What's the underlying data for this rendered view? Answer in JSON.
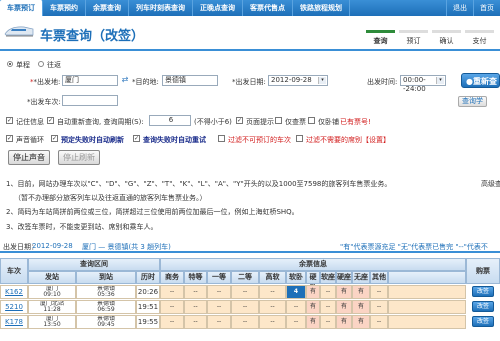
{
  "topnav": {
    "tabs": [
      "车票预订",
      "车票预约",
      "余票查询",
      "列车时刻表查询",
      "正晚点查询",
      "客票代售点",
      "铁路旅程规划"
    ],
    "utils": [
      "退出",
      "首页"
    ]
  },
  "header": {
    "title": "车票查询（改签）",
    "steps": [
      "查询",
      "预订",
      "确认",
      "支付"
    ]
  },
  "search": {
    "trip_single": "单程",
    "trip_round": "往返",
    "from_label": "*出发地:",
    "from_value": "厦门",
    "to_label": "*目的地:",
    "to_value": "景德镇",
    "date_label": "*出发日期:",
    "date_value": "2012-09-28",
    "time_label": "出发时间:",
    "time_value": "00:00--24:00",
    "search_button": "重新查",
    "station_label": "*出发车次:",
    "station_value": "",
    "query_more_button": "查询学"
  },
  "options": {
    "remember": "记住信息",
    "auto_requery": "自动重新查询, 查询周期(S):",
    "period_value": "6",
    "period_hint": "(不得小于6)",
    "page_notify": "页面提示",
    "show_only": "仅查票",
    "tip_title": "仅卧铺",
    "has_tickets": "已有票号!",
    "sound_loop": "声音循环",
    "auto_refresh": "预定失败时自动刷新",
    "query_fail_refresh": "查询失败时自动重试",
    "filter_unbookable": "过滤不可预订的车次",
    "filter_unneeded": "过滤不需要的席别【设置】"
  },
  "buttons": {
    "stop_sound": "停止声音",
    "stop_refresh": "停止刷新"
  },
  "notices": [
    "1、目前，网站办理车次以\"C\"、\"D\"、\"G\"、\"Z\"、\"T\"、\"K\"、\"L\"、\"A\"、\"Y\"开头的以及1000至7598的旅客列车售票业务。",
    "（暂不办理部分旅客列车以及往返直通的旅客列车售票业务。）",
    "2、简码为车站简拼前两位或三位，简拼超过三位使用前两位加最后一位，例如上海虹桥SHQ。",
    "3、改签车票时，不能变更到站、席别和乘车人。"
  ],
  "notice_right": "高级查",
  "result": {
    "label": "出发日期：",
    "date": "2012-09-28",
    "route": "厦门 — 景德镇(共 3 趟列车)",
    "legend": "\"有\"代表票源充足  \"无\"代表票已售完  \"--\"代表不"
  },
  "table": {
    "col_train": "车次",
    "group_interval": "查询区间",
    "group_seats": "余票信息",
    "col_depart": "发站",
    "col_arrive": "到站",
    "col_duration": "历时",
    "seat_cols": [
      "商务",
      "特等",
      "一等",
      "二等",
      "高软",
      "软卧",
      "硬卧",
      "软座",
      "硬座",
      "无座",
      "其他"
    ],
    "col_book": "购票",
    "rows": [
      {
        "train": "K162",
        "from": "厦门",
        "from_time": "09:10",
        "to": "景德镇",
        "to_time": "05:36",
        "duration": "20:26",
        "seats": [
          "--",
          "--",
          "--",
          "--",
          "--",
          "4",
          "有",
          "--",
          "有",
          "有",
          "--"
        ],
        "book": "改签"
      },
      {
        "train": "5210",
        "from": "厦门北站",
        "from_time": "11:28",
        "to": "景德镇",
        "to_time": "06:59",
        "duration": "19:51",
        "seats": [
          "--",
          "--",
          "--",
          "--",
          "--",
          "--",
          "有",
          "--",
          "有",
          "有",
          "--"
        ],
        "book": "改签"
      },
      {
        "train": "K178",
        "from": "厦门",
        "from_time": "13:50",
        "to": "景德镇",
        "to_time": "09:45",
        "duration": "19:55",
        "seats": [
          "--",
          "--",
          "--",
          "--",
          "--",
          "--",
          "有",
          "--",
          "有",
          "有",
          "--"
        ],
        "book": "改签"
      }
    ]
  }
}
